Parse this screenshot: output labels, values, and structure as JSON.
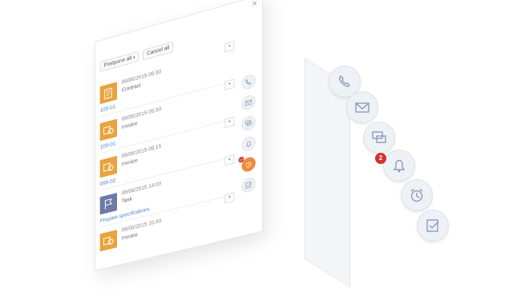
{
  "panel": {
    "close_label": "×",
    "postpone_label": "Postpone all",
    "cancel_label": "Cancel all",
    "items": [
      {
        "time": "09/06/2015 09:30",
        "label": "Contract",
        "code": "105-01",
        "kind": "doc"
      },
      {
        "time": "09/06/2015 09:30",
        "label": "Invoice",
        "code": "109-01",
        "kind": "doc"
      },
      {
        "time": "09/06/2015 09:15",
        "label": "Invoice",
        "code": "095-02",
        "kind": "doc"
      },
      {
        "time": "08/06/2015 14:00",
        "label": "Task",
        "code": "Prepare specifications",
        "kind": "task"
      },
      {
        "time": "08/06/2015 10:30",
        "label": "Invoice",
        "code": "",
        "kind": "doc"
      }
    ],
    "mini_badge": "10"
  },
  "strip": {
    "notification_badge": "2",
    "buttons": [
      "phone-icon",
      "mail-icon",
      "chat-icon",
      "bell-icon",
      "alarm-clock-icon",
      "task-icon"
    ]
  },
  "colors": {
    "doc_thumb": "#e8a33d",
    "task_thumb": "#6f79a8",
    "link": "#4f88c8",
    "badge": "#d2312c",
    "alarm_active": "#f08a3c"
  }
}
